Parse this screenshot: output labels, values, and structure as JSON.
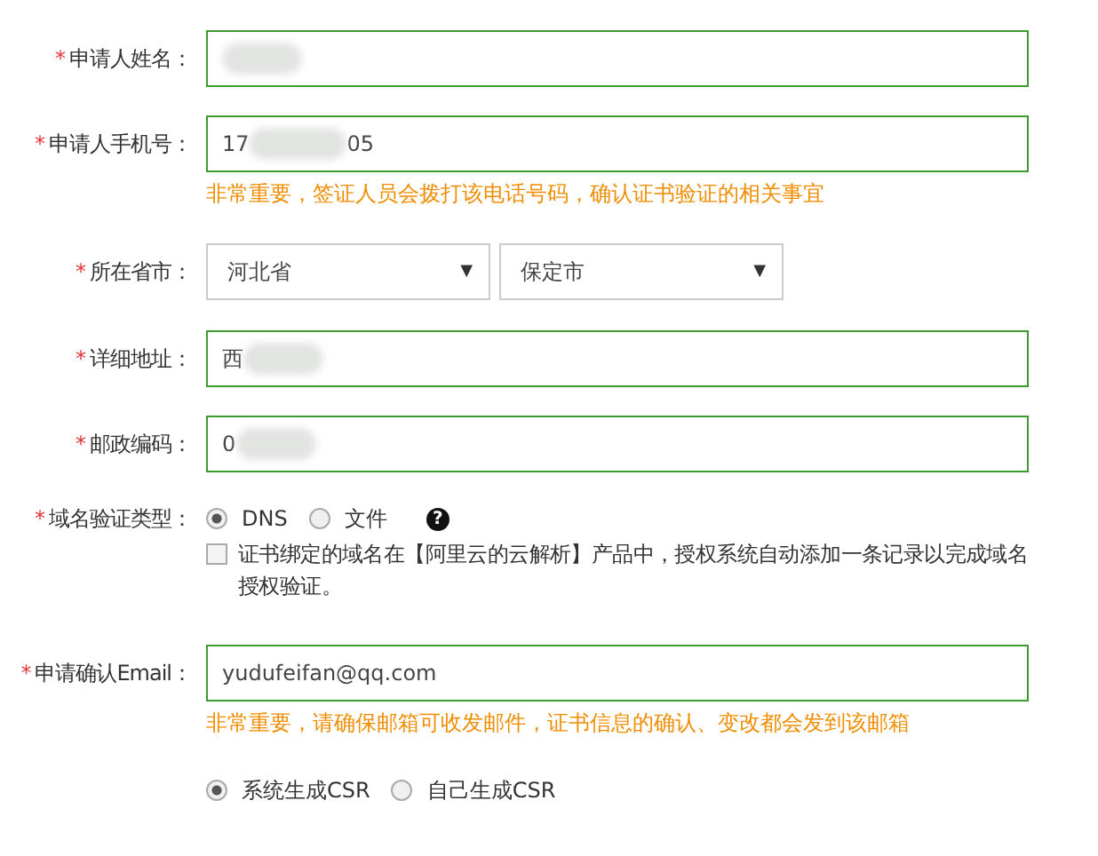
{
  "fields": [
    {
      "kind": "text",
      "mark": "*",
      "label": "申请人姓名：",
      "redacted": true
    },
    {
      "kind": "text",
      "mark": "*",
      "label": "申请人手机号：",
      "value_start": "17",
      "value_end": "05",
      "redacted": true,
      "hint": "非常重要，签证人员会拨打该电话号码，确认证书验证的相关事宜"
    },
    {
      "kind": "selects",
      "mark": "*",
      "label": "所在省市：",
      "selects": [
        {
          "value": "河北省",
          "arrow": "▼"
        },
        {
          "value": "保定市",
          "arrow": "▼"
        }
      ]
    },
    {
      "kind": "text",
      "mark": "*",
      "label": "详细地址：",
      "value_start": "西",
      "redacted": true
    },
    {
      "kind": "text",
      "mark": "*",
      "label": "邮政编码：",
      "value_start": "0",
      "redacted": true
    },
    {
      "kind": "radios",
      "mark": "*",
      "label": "域名验证类型：",
      "options": [
        {
          "label": "DNS",
          "selected": true
        },
        {
          "label": "文件",
          "selected": false
        }
      ],
      "help": "?",
      "checkbox": {
        "label": "证书绑定的域名在【阿里云的云解析】产品中，授权系统自动添加一条记录以完成域名授权验证。",
        "checked": false
      }
    },
    {
      "kind": "text",
      "mark": "*",
      "label": "申请确认Email：",
      "value_start": "yudufeifan@qq.com",
      "hint": "非常重要，请确保邮箱可收发邮件，证书信息的确认、变改都会发到该邮箱"
    },
    {
      "kind": "radios",
      "options": [
        {
          "label": "系统生成CSR",
          "selected": true
        },
        {
          "label": "自己生成CSR",
          "selected": false
        }
      ]
    }
  ]
}
